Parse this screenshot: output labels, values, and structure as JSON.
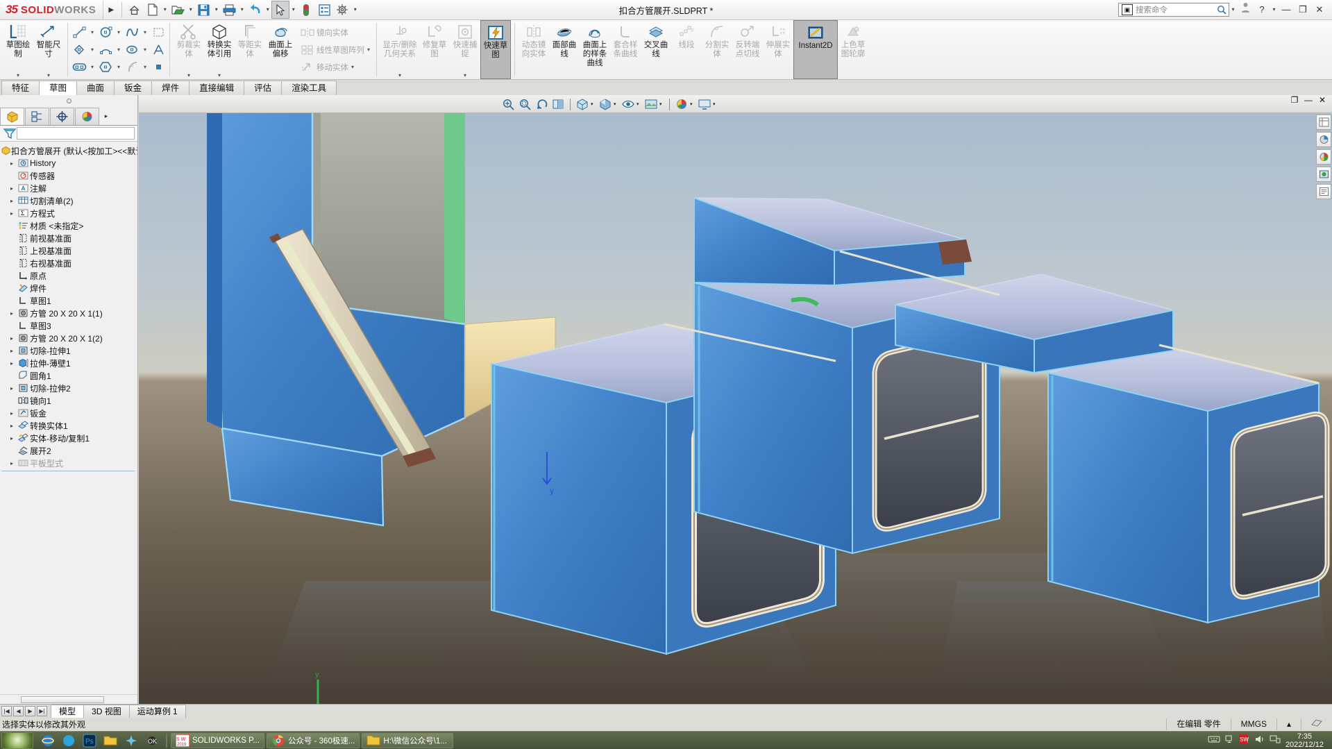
{
  "titlebar": {
    "brand_ds": "35",
    "brand_solid": "SOLID",
    "brand_works": "WORKS",
    "document_title": "扣合方管展开.SLDPRT *",
    "buttons": [
      {
        "name": "home",
        "glyph": "⌂"
      },
      {
        "name": "new",
        "glyph": "🗋"
      },
      {
        "name": "open",
        "glyph": "📂"
      },
      {
        "name": "save",
        "glyph": "💾"
      },
      {
        "name": "print",
        "glyph": "🖨"
      },
      {
        "name": "undo",
        "glyph": "↶"
      },
      {
        "name": "select",
        "glyph": "➤"
      },
      {
        "name": "rebuild",
        "glyph": "●"
      },
      {
        "name": "options-list",
        "glyph": "▤"
      },
      {
        "name": "settings",
        "glyph": "⚙"
      }
    ],
    "search_placeholder": "搜索命令",
    "help_label": "?",
    "minimize": "—",
    "restore": "❐",
    "close": "✕"
  },
  "ribbon": {
    "groups": [
      {
        "name": "sketch-tools",
        "buttons": [
          {
            "label": "草图绘制",
            "enabled": true,
            "dropdown": true,
            "icon": "sketch-icon"
          },
          {
            "label": "智能尺寸",
            "enabled": true,
            "dropdown": true,
            "icon": "dimension-icon"
          }
        ]
      },
      {
        "name": "entities",
        "small": [
          [
            "line-icon",
            "circle-icon",
            "spline-icon",
            "rectangle-sketch-icon"
          ],
          [
            "polygon-corner-icon",
            "arc-icon",
            "ellipse-icon",
            "text-icon"
          ],
          [
            "slot-icon",
            "polygon-icon",
            "fillet-icon",
            "point-icon"
          ]
        ]
      },
      {
        "name": "modify-tools",
        "buttons": [
          {
            "label": "剪裁实体",
            "enabled": false,
            "dropdown": true,
            "icon": "trim-icon"
          },
          {
            "label": "转换实体引用",
            "enabled": true,
            "dropdown": true,
            "icon": "convert-entities-icon"
          },
          {
            "label": "等距实体",
            "enabled": false,
            "dropdown": false,
            "icon": "offset-icon"
          },
          {
            "label": "曲面上偏移",
            "enabled": true,
            "dropdown": false,
            "icon": "offset-surface-icon"
          }
        ]
      },
      {
        "name": "pattern-tools",
        "list": [
          {
            "label": "镜向实体",
            "enabled": false,
            "icon": "mirror-icon"
          },
          {
            "label": "线性草图阵列",
            "enabled": false,
            "icon": "linear-pattern-icon",
            "dropdown": true
          },
          {
            "label": "移动实体",
            "enabled": false,
            "icon": "move-entities-icon",
            "dropdown": true
          }
        ]
      },
      {
        "name": "relations-tools",
        "buttons": [
          {
            "label": "显示/删除几何关系",
            "enabled": false,
            "dropdown": true,
            "icon": "display-delete-relations-icon"
          },
          {
            "label": "修复草图",
            "enabled": false,
            "dropdown": false,
            "icon": "repair-sketch-icon"
          },
          {
            "label": "快速捕捉",
            "enabled": false,
            "dropdown": true,
            "icon": "quick-snap-icon"
          },
          {
            "label": "快速草图",
            "enabled": true,
            "active": true,
            "dropdown": false,
            "icon": "rapid-sketch-icon"
          }
        ]
      },
      {
        "name": "curve-tools",
        "buttons": [
          {
            "label": "动态镜向实体",
            "enabled": false,
            "dropdown": false,
            "icon": "dynamic-mirror-icon"
          },
          {
            "label": "面部曲线",
            "enabled": true,
            "dropdown": false,
            "icon": "face-curves-icon"
          },
          {
            "label": "曲面上的样条曲线",
            "enabled": true,
            "dropdown": false,
            "icon": "spline-on-surface-icon"
          },
          {
            "label": "套合样条曲线",
            "enabled": false,
            "dropdown": false,
            "icon": "fit-spline-icon"
          },
          {
            "label": "交叉曲线",
            "enabled": true,
            "dropdown": false,
            "icon": "intersection-curve-icon"
          },
          {
            "label": "线段",
            "enabled": false,
            "dropdown": false,
            "icon": "segment-icon"
          },
          {
            "label": "分割实体",
            "enabled": false,
            "dropdown": false,
            "icon": "split-entities-icon"
          },
          {
            "label": "反转端点切线",
            "enabled": false,
            "dropdown": false,
            "icon": "reverse-tangent-icon"
          },
          {
            "label": "伸展实体",
            "enabled": false,
            "dropdown": false,
            "icon": "stretch-entities-icon"
          },
          {
            "label": "Instant2D",
            "enabled": true,
            "active": true,
            "dropdown": false,
            "icon": "instant2d-icon"
          },
          {
            "label": "上色草图轮廓",
            "enabled": false,
            "dropdown": false,
            "icon": "shaded-sketch-contours-icon"
          }
        ]
      }
    ]
  },
  "tabs": {
    "items": [
      {
        "label": "特征",
        "active": false
      },
      {
        "label": "草图",
        "active": true
      },
      {
        "label": "曲面",
        "active": false
      },
      {
        "label": "钣金",
        "active": false
      },
      {
        "label": "焊件",
        "active": false
      },
      {
        "label": "直接编辑",
        "active": false
      },
      {
        "label": "评估",
        "active": false
      },
      {
        "label": "渲染工具",
        "active": false
      }
    ]
  },
  "left_panel": {
    "pm_tabs": [
      {
        "name": "feature-manager-tab",
        "icon": "feature-tree-icon",
        "active": true
      },
      {
        "name": "property-manager-tab",
        "icon": "property-manager-icon",
        "active": false
      },
      {
        "name": "configuration-manager-tab",
        "icon": "configuration-icon",
        "active": false
      },
      {
        "name": "display-manager-tab",
        "icon": "display-manager-icon",
        "active": false
      }
    ],
    "filter_placeholder": "",
    "tree": [
      {
        "label": "扣合方管展开  (默认<按加工><<默认>",
        "icon": "part-icon",
        "expand": false,
        "indent": 0,
        "root": true
      },
      {
        "label": "History",
        "icon": "history-icon",
        "expand": true,
        "indent": 1
      },
      {
        "label": "传感器",
        "icon": "sensor-icon",
        "expand": false,
        "indent": 1
      },
      {
        "label": "注解",
        "icon": "annotations-icon",
        "expand": true,
        "indent": 1
      },
      {
        "label": "切割清单(2)",
        "icon": "cut-list-icon",
        "expand": true,
        "indent": 1
      },
      {
        "label": "方程式",
        "icon": "equations-icon",
        "expand": true,
        "indent": 1
      },
      {
        "label": "材质 <未指定>",
        "icon": "material-icon",
        "expand": false,
        "indent": 1
      },
      {
        "label": "前视基准面",
        "icon": "plane-icon",
        "expand": false,
        "indent": 1
      },
      {
        "label": "上视基准面",
        "icon": "plane-icon",
        "expand": false,
        "indent": 1
      },
      {
        "label": "右视基准面",
        "icon": "plane-icon",
        "expand": false,
        "indent": 1
      },
      {
        "label": "原点",
        "icon": "origin-icon",
        "expand": false,
        "indent": 1
      },
      {
        "label": "焊件",
        "icon": "weldment-icon",
        "expand": false,
        "indent": 1
      },
      {
        "label": "草图1",
        "icon": "sketch-icon",
        "expand": false,
        "indent": 1
      },
      {
        "label": "方管 20 X 20 X 1(1)",
        "icon": "structural-member-icon",
        "expand": true,
        "indent": 1
      },
      {
        "label": "草图3",
        "icon": "sketch-icon",
        "expand": false,
        "indent": 1
      },
      {
        "label": "方管 20 X 20 X 1(2)",
        "icon": "structural-member-icon",
        "expand": true,
        "indent": 1
      },
      {
        "label": "切除-拉伸1",
        "icon": "extrude-cut-icon",
        "expand": true,
        "indent": 1
      },
      {
        "label": "拉伸-薄壁1",
        "icon": "thin-extrude-icon",
        "expand": true,
        "indent": 1
      },
      {
        "label": "圆角1",
        "icon": "fillet-icon",
        "expand": false,
        "indent": 1
      },
      {
        "label": "切除-拉伸2",
        "icon": "extrude-cut-icon",
        "expand": true,
        "indent": 1
      },
      {
        "label": "镜向1",
        "icon": "mirror-icon",
        "expand": false,
        "indent": 1
      },
      {
        "label": "钣金",
        "icon": "sheet-metal-icon",
        "expand": true,
        "indent": 1
      },
      {
        "label": "转换实体1",
        "icon": "convert-solid-icon",
        "expand": true,
        "indent": 1
      },
      {
        "label": "实体-移动/复制1",
        "icon": "move-copy-body-icon",
        "expand": true,
        "indent": 1
      },
      {
        "label": "展开2",
        "icon": "unfold-icon",
        "expand": false,
        "indent": 1
      },
      {
        "label": "平板型式",
        "icon": "flat-pattern-icon",
        "expand": true,
        "indent": 1,
        "greyed": true
      }
    ]
  },
  "view_toolbar": {
    "buttons": [
      {
        "name": "zoom-to-fit",
        "glyph": "⌖"
      },
      {
        "name": "zoom-to-area",
        "glyph": "⌕"
      },
      {
        "name": "previous-view",
        "glyph": "↺"
      },
      {
        "name": "section-view",
        "glyph": "◨"
      },
      {
        "name": "view-orientation",
        "glyph": "⬛",
        "dropdown": true
      },
      {
        "name": "display-style",
        "glyph": "◧",
        "dropdown": true
      },
      {
        "name": "hide-show-items",
        "glyph": "👁",
        "dropdown": true
      },
      {
        "name": "edit-appearance",
        "glyph": "◉",
        "dropdown": true
      },
      {
        "name": "apply-scene",
        "glyph": "▦",
        "dropdown": true
      },
      {
        "name": "view-settings",
        "glyph": "🖵",
        "dropdown": true
      }
    ],
    "window_controls": [
      "◱",
      "—",
      "✕"
    ],
    "right_dock": [
      {
        "name": "view-palette-icon",
        "glyph": "▤"
      },
      {
        "name": "appearances-icon",
        "glyph": "◧"
      },
      {
        "name": "scenes-icon",
        "glyph": "◔"
      },
      {
        "name": "decals-icon",
        "glyph": "◑"
      },
      {
        "name": "custom-properties-icon",
        "glyph": "▥"
      }
    ]
  },
  "bottom": {
    "nav_buttons": [
      "|◀",
      "◀",
      "▶",
      "▶|"
    ],
    "tabs": [
      {
        "label": "模型",
        "active": true
      },
      {
        "label": "3D 视图",
        "active": false
      },
      {
        "label": "运动算例 1",
        "active": false
      }
    ],
    "status_message": "选择实体以修改其外观",
    "status_cells": [
      "在编辑 零件",
      "MMGS",
      "▴"
    ]
  },
  "taskbar": {
    "quick_icons": [
      {
        "name": "ie-icon",
        "glyph": "◉"
      },
      {
        "name": "firefox-icon",
        "glyph": "◍"
      },
      {
        "name": "photoshop-icon",
        "glyph": "Ps"
      },
      {
        "name": "explorer-icon",
        "glyph": "📁"
      },
      {
        "name": "cleaner-icon",
        "glyph": "✲"
      },
      {
        "name": "settings-icon",
        "glyph": "✦"
      }
    ],
    "items": [
      {
        "label": "SOLIDWORKS P...",
        "icon": "solidworks-taskbar-icon",
        "badge": "2019"
      },
      {
        "label": "公众号 - 360极速...",
        "icon": "browser-taskbar-icon"
      },
      {
        "label": "H:\\微信公众号\\1...",
        "icon": "folder-taskbar-icon"
      }
    ],
    "tray_icons": [
      "⌨",
      "▱",
      "⚠",
      "🔊",
      "🖵"
    ],
    "clock_time": "7:35",
    "clock_date": "2022/12/12"
  }
}
